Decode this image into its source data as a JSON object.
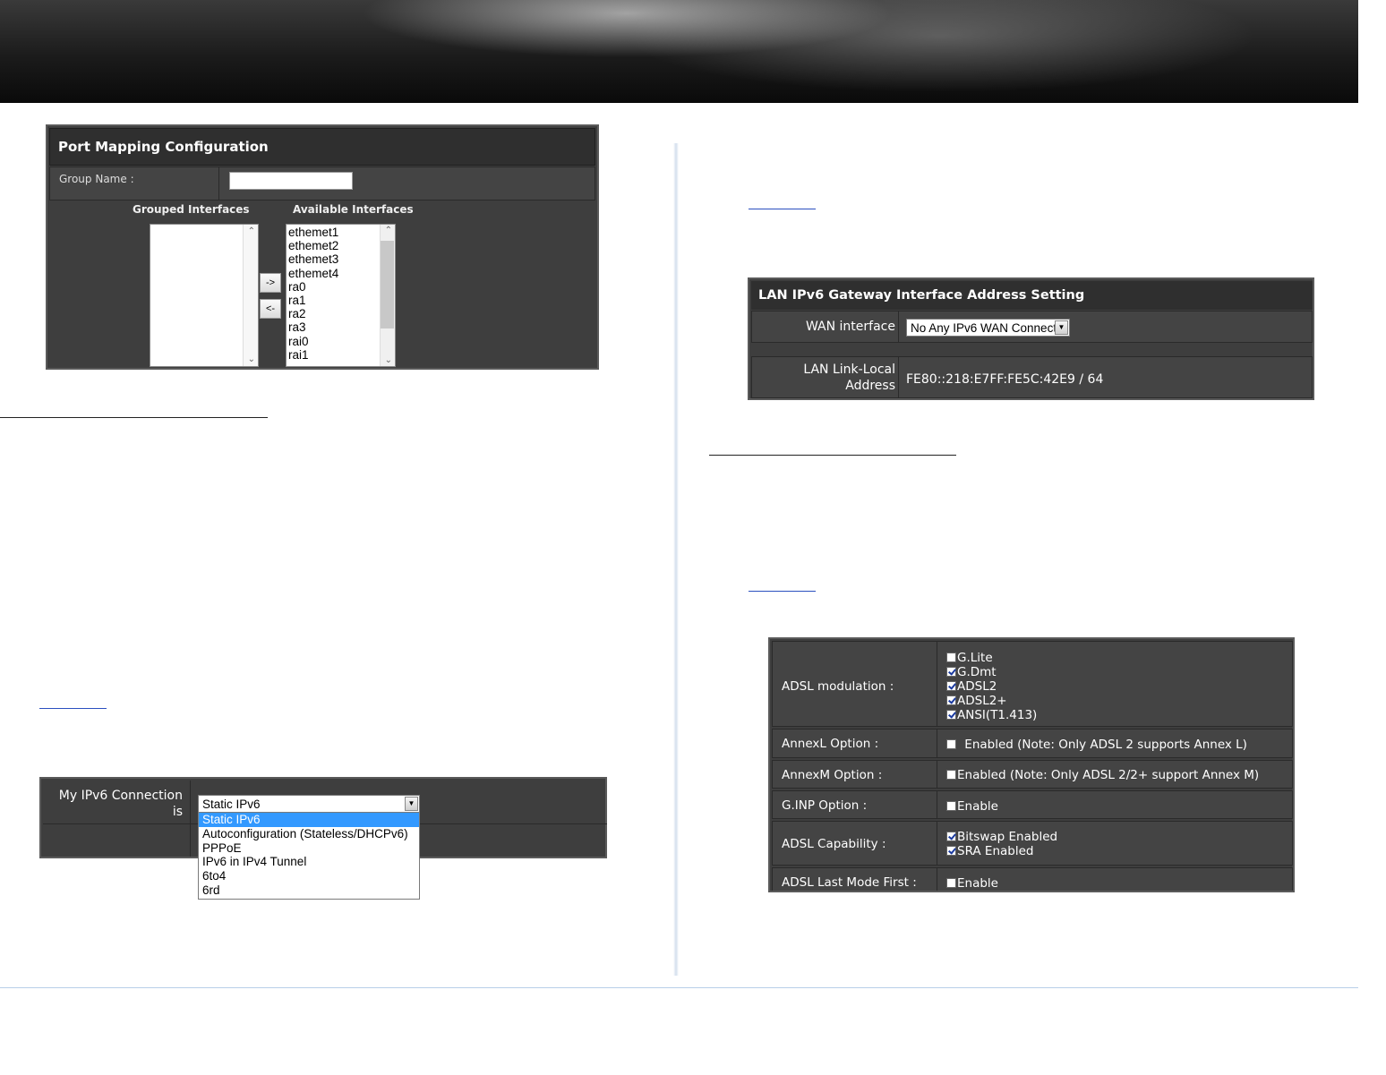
{
  "port_mapping": {
    "title": "Port Mapping Configuration",
    "group_name_label": "Group Name :",
    "group_name_value": "",
    "grouped_interfaces_label": "Grouped Interfaces",
    "available_interfaces_label": "Available Interfaces",
    "grouped_interfaces": [],
    "available_interfaces": [
      "ethemet1",
      "ethemet2",
      "ethemet3",
      "ethemet4",
      "ra0",
      "ra1",
      "ra2",
      "ra3",
      "rai0",
      "rai1"
    ],
    "add_button": "->",
    "remove_button": "<-"
  },
  "ipv6_connection": {
    "label": "My IPv6 Connection is",
    "selected": "Static IPv6",
    "options": [
      "Static IPv6",
      "Autoconfiguration (Stateless/DHCPv6)",
      "PPPoE",
      "IPv6 in IPv4 Tunnel",
      "6to4",
      "6rd"
    ]
  },
  "lan_gateway": {
    "title": "LAN IPv6 Gateway Interface Address Setting",
    "wan_interface_label": "WAN interface",
    "wan_interface_value": "No Any IPv6 WAN Connect",
    "link_local_label_line1": "LAN Link-Local",
    "link_local_label_line2": "Address",
    "link_local_value": "FE80::218:E7FF:FE5C:42E9 / 64"
  },
  "adsl": {
    "modulation_label": "ADSL modulation :",
    "modulation_options": [
      {
        "label": "G.Lite",
        "checked": false
      },
      {
        "label": "G.Dmt",
        "checked": true
      },
      {
        "label": "ADSL2",
        "checked": true
      },
      {
        "label": "ADSL2+",
        "checked": true
      },
      {
        "label": "ANSI(T1.413)",
        "checked": true
      }
    ],
    "annexl_label": "AnnexL Option :",
    "annexl_text": "Enabled (Note: Only ADSL 2 supports Annex L)",
    "annexl_checked": false,
    "annexm_label": "AnnexM Option :",
    "annexm_text": "Enabled (Note: Only ADSL 2/2+ support Annex M)",
    "annexm_checked": false,
    "ginp_label": "G.INP Option :",
    "ginp_text": "Enable",
    "ginp_checked": false,
    "capability_label": "ADSL Capability :",
    "capability_options": [
      {
        "label": "Bitswap Enabled",
        "checked": true
      },
      {
        "label": "SRA Enabled",
        "checked": true
      }
    ],
    "last_mode_label": "ADSL Last Mode First :",
    "last_mode_text": "Enable",
    "last_mode_checked": false
  }
}
